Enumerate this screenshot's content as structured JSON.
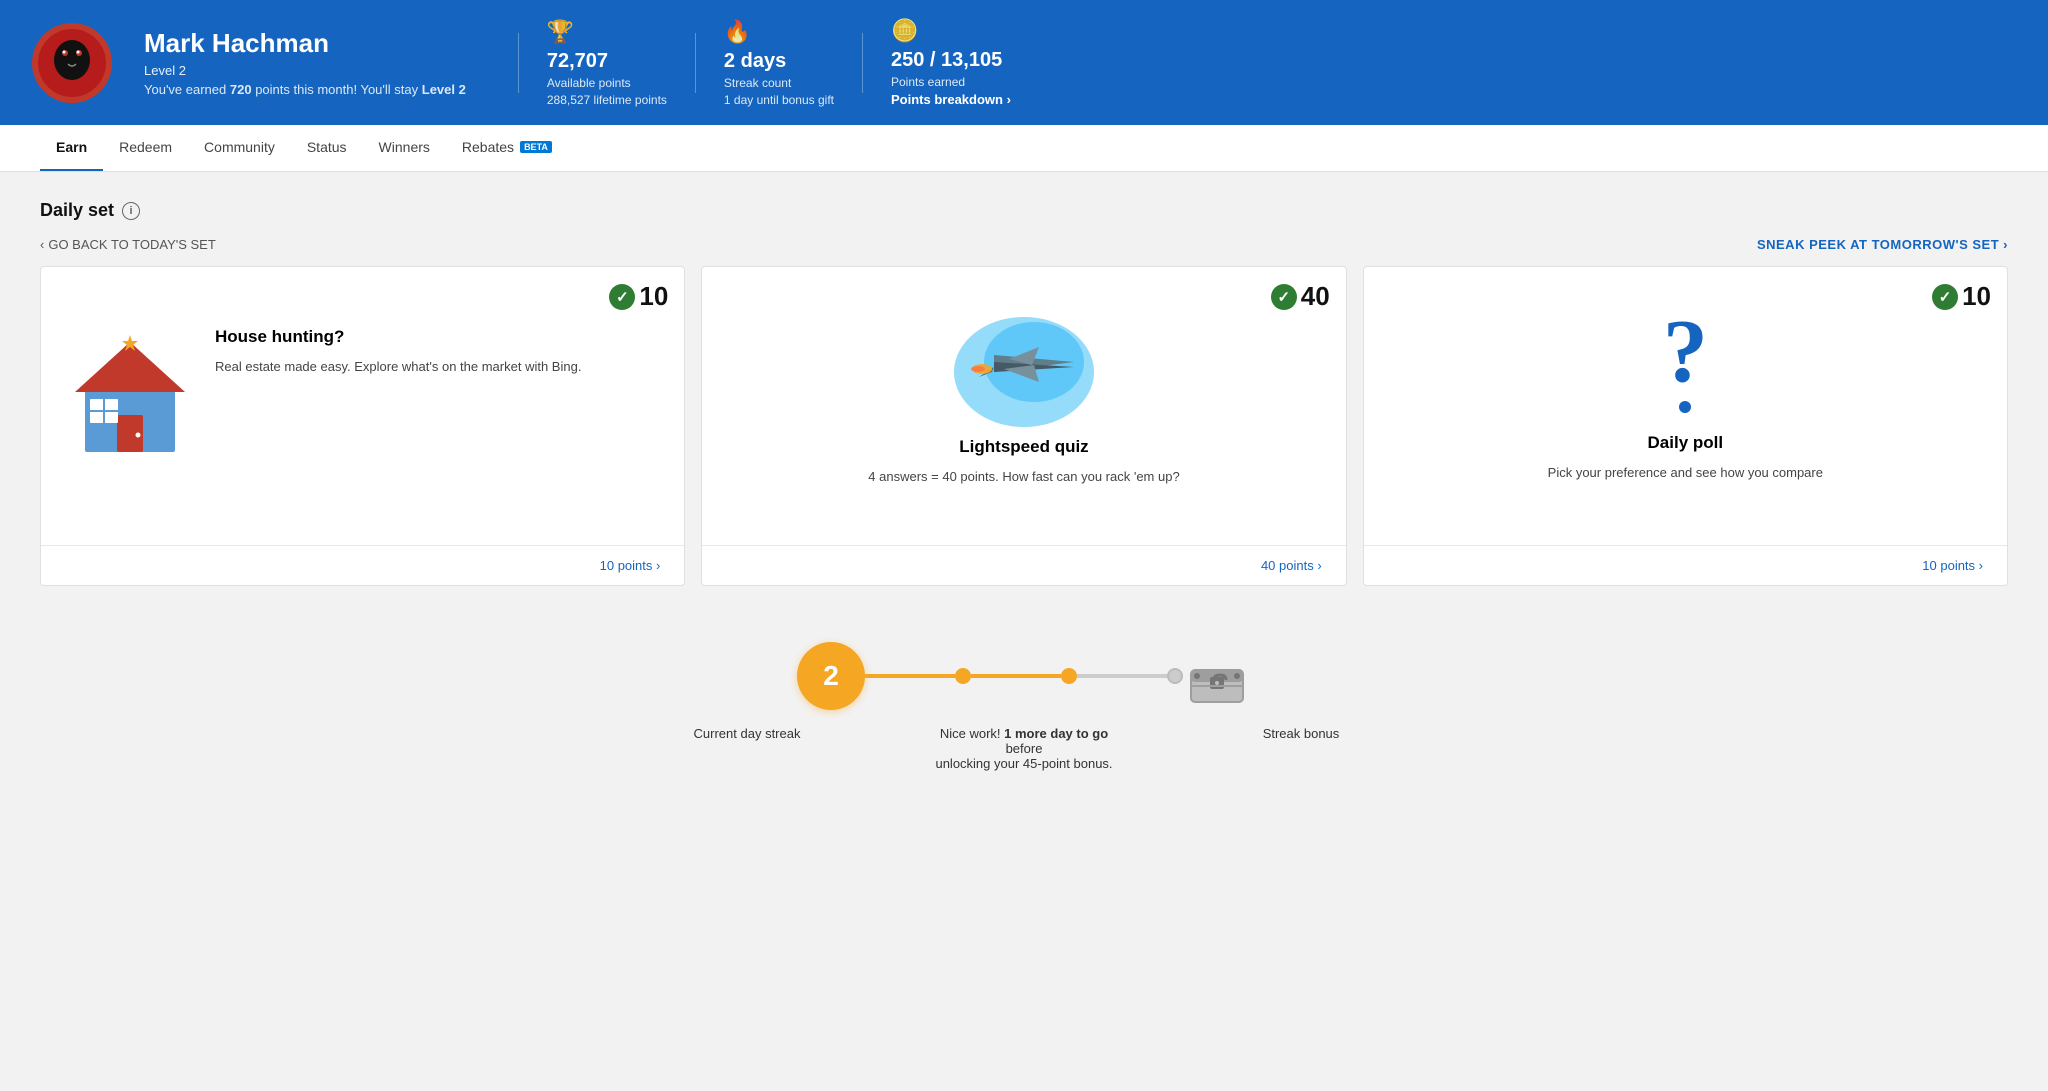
{
  "header": {
    "user_name": "Mark Hachman",
    "user_level": "Level 2",
    "earned_message": "You've earned",
    "earned_points": "720",
    "earned_suffix": "points this month! You'll stay",
    "earned_level": "Level 2",
    "stats": [
      {
        "icon": "trophy",
        "main": "72,707",
        "label": "Available points",
        "sub": "288,527 lifetime points"
      },
      {
        "icon": "flame",
        "main": "2 days",
        "label": "Streak count",
        "sub": "1 day until bonus gift"
      },
      {
        "icon": "coins",
        "main": "250 / 13,105",
        "label": "Points earned",
        "link": "Points breakdown ›"
      }
    ]
  },
  "nav": {
    "items": [
      {
        "label": "Earn",
        "active": true
      },
      {
        "label": "Redeem",
        "active": false
      },
      {
        "label": "Community",
        "active": false
      },
      {
        "label": "Status",
        "active": false
      },
      {
        "label": "Winners",
        "active": false
      },
      {
        "label": "Rebates",
        "active": false,
        "badge": "BETA"
      }
    ]
  },
  "daily_set": {
    "title": "Daily set",
    "back_label": "GO BACK TO TODAY'S SET",
    "forward_label": "SNEAK PEEK AT TOMORROW'S SET",
    "cards": [
      {
        "id": "card-1",
        "score": "10",
        "title": "House hunting?",
        "desc": "Real estate made easy. Explore what's on the market with Bing.",
        "link": "10 points ›"
      },
      {
        "id": "card-2",
        "score": "40",
        "title": "Lightspeed quiz",
        "desc": "4 answers = 40 points. How fast can you rack 'em up?",
        "link": "40 points ›"
      },
      {
        "id": "card-3",
        "score": "10",
        "title": "Daily poll",
        "desc": "Pick your preference and see how you compare",
        "link": "10 points ›"
      }
    ]
  },
  "streak": {
    "count": "2",
    "label": "Current day streak",
    "middle_text_bold": "1 more day to go",
    "middle_text_pre": "Nice work!",
    "middle_text_post": "before\nunlocking your 45-point bonus.",
    "bonus_label": "Streak bonus"
  }
}
